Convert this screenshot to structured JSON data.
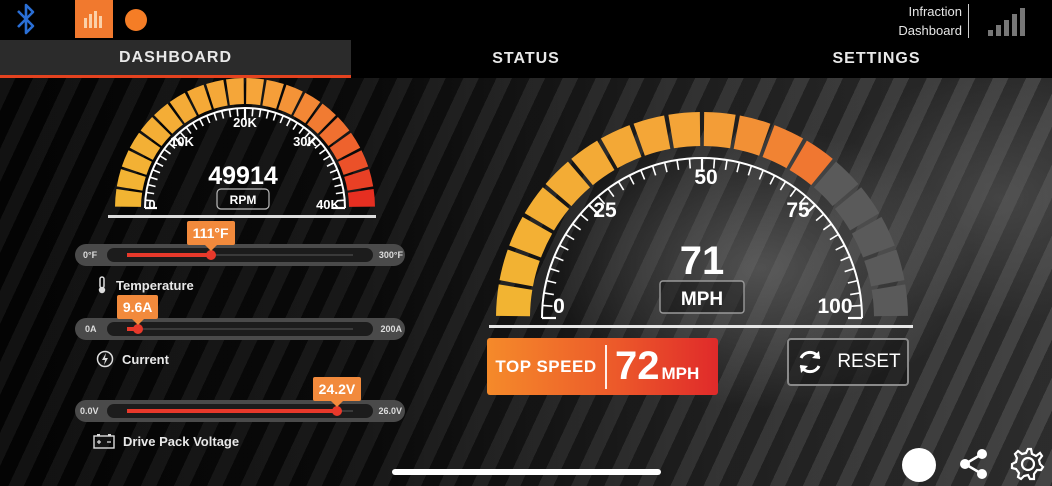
{
  "header": {
    "app_title_line1": "Infraction",
    "app_title_line2": "Dashboard",
    "icons": [
      "bluetooth-icon",
      "app-logo-icon",
      "status-dot-icon",
      "signal-strength-icon"
    ],
    "brand_color": "#f1792e",
    "bluetooth_color": "#2a6fd6"
  },
  "nav": {
    "tabs": [
      {
        "label": "DASHBOARD",
        "active": true
      },
      {
        "label": "STATUS",
        "active": false
      },
      {
        "label": "SETTINGS",
        "active": false
      }
    ],
    "active_color": "#e4421f"
  },
  "rpm_gauge": {
    "value": "49914",
    "unit": "RPM",
    "ticks": [
      "0",
      "10K",
      "20K",
      "30K",
      "40K"
    ],
    "min": 0,
    "max": 40000
  },
  "bars": [
    {
      "name": "Temperature",
      "min_label": "0°F",
      "max_label": "300°F",
      "value_label": "111°F",
      "fraction": 0.37,
      "icon": "thermometer-icon"
    },
    {
      "name": "Current",
      "min_label": "0A",
      "max_label": "200A",
      "value_label": "9.6A",
      "fraction": 0.048,
      "icon": "lightning-icon"
    },
    {
      "name": "Drive Pack Voltage",
      "min_label": "0.0V",
      "max_label": "26.0V",
      "value_label": "24.2V",
      "fraction": 0.93,
      "icon": "battery-icon"
    }
  ],
  "speed_gauge": {
    "value": "71",
    "unit": "MPH",
    "ticks": [
      "0",
      "25",
      "50",
      "75",
      "100"
    ],
    "min": 0,
    "max": 100
  },
  "top_speed": {
    "label": "TOP SPEED",
    "value": "72",
    "unit": "MPH"
  },
  "reset": {
    "label": "RESET"
  },
  "footer_icons": [
    "circle-button-icon",
    "share-icon",
    "gear-icon"
  ]
}
